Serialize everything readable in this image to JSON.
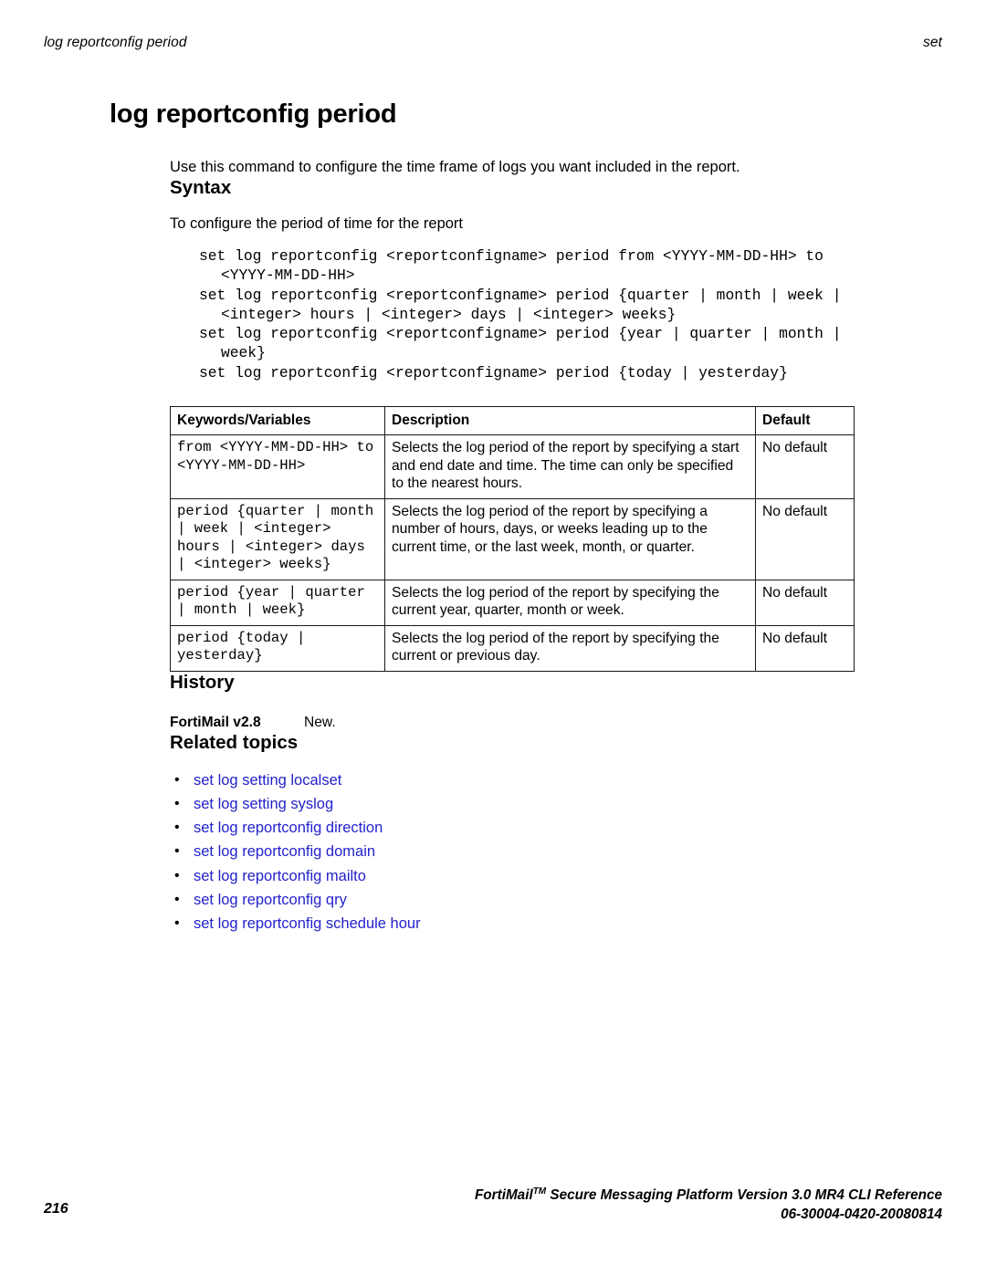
{
  "running_header": {
    "left": "log reportconfig period",
    "right": "set"
  },
  "title": "log reportconfig period",
  "intro": "Use this command to configure the time frame of logs you want included in the report.",
  "sections": {
    "syntax": {
      "heading": "Syntax",
      "lead": "To configure the period of time for the report",
      "lines": [
        {
          "text": "set log reportconfig <reportconfigname> period from <YYYY-MM-DD-HH> to",
          "continuation": false
        },
        {
          "text": "<YYYY-MM-DD-HH>",
          "continuation": true
        },
        {
          "text": "set log reportconfig <reportconfigname> period {quarter | month | week |",
          "continuation": false
        },
        {
          "text": "<integer> hours | <integer> days | <integer> weeks}",
          "continuation": true
        },
        {
          "text": "set log reportconfig <reportconfigname> period {year | quarter | month |",
          "continuation": false
        },
        {
          "text": "week}",
          "continuation": true
        },
        {
          "text": "set log reportconfig <reportconfigname> period {today | yesterday}",
          "continuation": false
        }
      ]
    },
    "history": {
      "heading": "History",
      "version": "FortiMail v2.8",
      "note": "New."
    },
    "related": {
      "heading": "Related topics",
      "items": [
        "set log setting localset",
        "set log setting syslog",
        "set log reportconfig direction",
        "set log reportconfig domain",
        "set log reportconfig mailto",
        "set log reportconfig qry",
        "set log reportconfig schedule hour"
      ],
      "bullet": "•",
      "link_color": "#2222cc"
    }
  },
  "keywords_table": {
    "headers": [
      "Keywords/Variables",
      "Description",
      "Default"
    ],
    "rows": [
      {
        "keyword": "from <YYYY-MM-DD-HH> to\n<YYYY-MM-DD-HH>",
        "description": "Selects the log period of the report by specifying a start and end date and time. The time can only be specified to the nearest hours.",
        "default": "No default"
      },
      {
        "keyword": "period {quarter | month\n| week | <integer>\nhours | <integer> days\n| <integer> weeks}",
        "description": "Selects the log period of the report by specifying a number of hours, days, or weeks leading up to the current time, or the last week, month, or quarter.",
        "default": "No default"
      },
      {
        "keyword": "period {year | quarter\n| month | week}",
        "description": "Selects the log period of the report by specifying the current year, quarter, month or week.",
        "default": "No default"
      },
      {
        "keyword": "period {today |\nyesterday}",
        "description": "Selects the log period of the report by specifying the current or previous day.",
        "default": "No default"
      }
    ]
  },
  "footer": {
    "product_line_pre": "FortiMail",
    "product_line_tm": "TM",
    "product_line_post": " Secure Messaging Platform Version 3.0 MR4 CLI Reference",
    "doc_number": "06-30004-0420-20080814",
    "page_number": "216"
  }
}
